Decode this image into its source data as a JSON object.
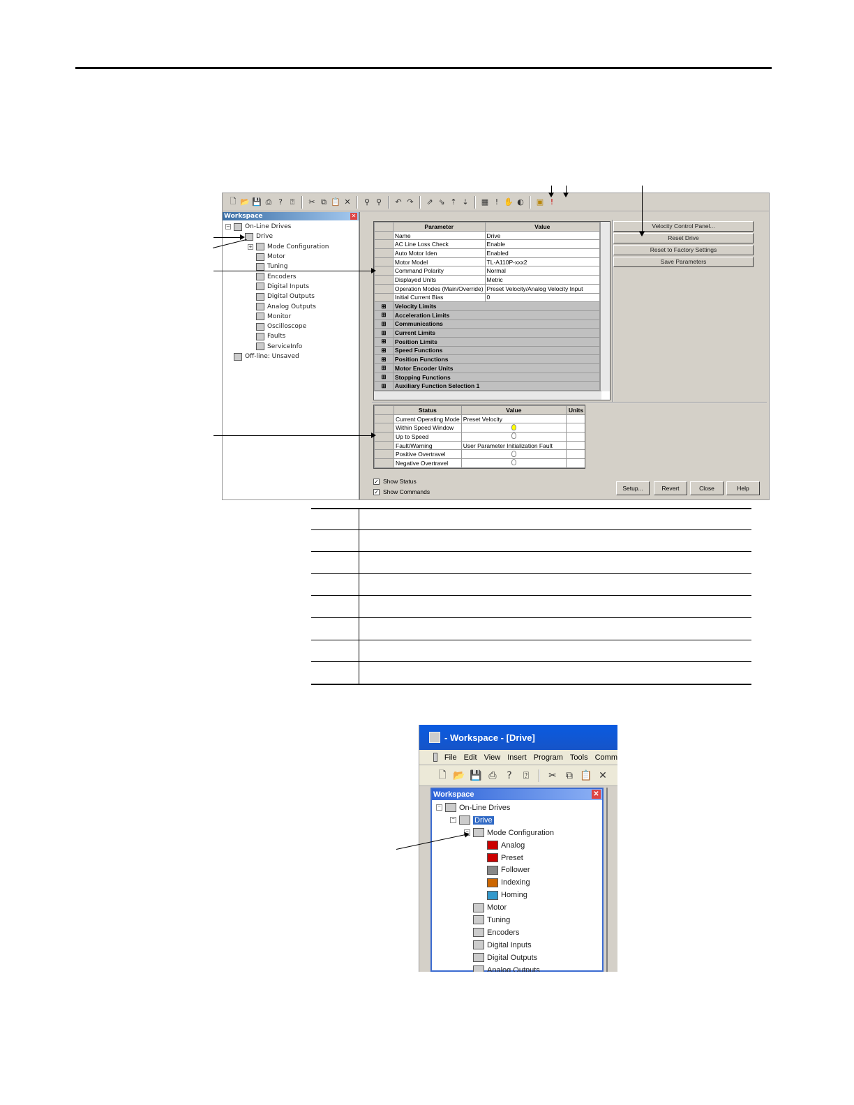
{
  "screenshot1": {
    "toolbar": {
      "icons": [
        "new-icon",
        "open-icon",
        "save-icon",
        "print-icon",
        "help-icon",
        "context-help-icon",
        "cut-icon",
        "copy-icon",
        "paste-icon",
        "delete-icon",
        "find-icon",
        "find-next-icon",
        "undo-icon",
        "redo-icon",
        "connect-icon",
        "disconnect-icon",
        "upload-icon",
        "download-icon",
        "calculator-icon",
        "enable-icon",
        "stop-icon",
        "home-icon",
        "properties-icon",
        "warning-icon"
      ]
    },
    "workspace": {
      "title": "Workspace",
      "items": [
        {
          "label": "On-Line Drives",
          "level": 0,
          "expander": "−"
        },
        {
          "label": "Drive",
          "level": 1,
          "expander": ""
        },
        {
          "label": "Mode Configuration",
          "level": 2,
          "expander": "+"
        },
        {
          "label": "Motor",
          "level": 2,
          "expander": ""
        },
        {
          "label": "Tuning",
          "level": 2,
          "expander": ""
        },
        {
          "label": "Encoders",
          "level": 2,
          "expander": ""
        },
        {
          "label": "Digital Inputs",
          "level": 2,
          "expander": ""
        },
        {
          "label": "Digital Outputs",
          "level": 2,
          "expander": ""
        },
        {
          "label": "Analog Outputs",
          "level": 2,
          "expander": ""
        },
        {
          "label": "Monitor",
          "level": 2,
          "expander": ""
        },
        {
          "label": "Oscilloscope",
          "level": 2,
          "expander": ""
        },
        {
          "label": "Faults",
          "level": 2,
          "expander": ""
        },
        {
          "label": "ServiceInfo",
          "level": 2,
          "expander": ""
        },
        {
          "label": "Off-line: Unsaved",
          "level": 0,
          "expander": ""
        }
      ]
    },
    "params": {
      "col_param": "Parameter",
      "col_value": "Value",
      "rows": [
        {
          "name": "Name",
          "value": "Drive"
        },
        {
          "name": "AC Line Loss Check",
          "value": "Enable"
        },
        {
          "name": "Auto Motor Iden",
          "value": "Enabled"
        },
        {
          "name": "Motor Model",
          "value": "TL-A110P-xxx2"
        },
        {
          "name": "Command Polarity",
          "value": "Normal"
        },
        {
          "name": "Displayed Units",
          "value": "Metric"
        },
        {
          "name": "Operation Modes (Main/Override)",
          "value": "Preset Velocity/Analog Velocity Input"
        },
        {
          "name": "Initial Current Bias",
          "value": "0"
        }
      ],
      "groups": [
        "Velocity Limits",
        "Acceleration Limits",
        "Communications",
        "Current Limits",
        "Position Limits",
        "Speed Functions",
        "Position Functions",
        "Motor Encoder Units",
        "Stopping Functions",
        "Auxiliary Function Selection 1"
      ]
    },
    "buttons": [
      "Velocity Control Panel...",
      "Reset Drive",
      "Reset to Factory Settings",
      "Save Parameters"
    ],
    "status": {
      "col_status": "Status",
      "col_value": "Value",
      "col_units": "Units",
      "rows": [
        {
          "name": "Current Operating Mode",
          "value": "Preset Velocity",
          "bulb": ""
        },
        {
          "name": "Within Speed Window",
          "value": "",
          "bulb": "on"
        },
        {
          "name": "Up to Speed",
          "value": "",
          "bulb": "off"
        },
        {
          "name": "Fault/Warning",
          "value": "User Parameter Initialization Fault",
          "bulb": ""
        },
        {
          "name": "Positive Overtravel",
          "value": "",
          "bulb": "off"
        },
        {
          "name": "Negative Overtravel",
          "value": "",
          "bulb": "off"
        }
      ]
    },
    "checkboxes": {
      "show_status": "Show Status",
      "show_commands": "Show Commands"
    },
    "bottom_buttons": [
      "Setup...",
      "Revert",
      "Close",
      "Help"
    ]
  },
  "screenshot2": {
    "title": "- Workspace - [Drive]",
    "menu": [
      "File",
      "Edit",
      "View",
      "Insert",
      "Program",
      "Tools",
      "Comm"
    ],
    "workspace_title": "Workspace",
    "items": [
      {
        "label": "On-Line Drives",
        "level": 0,
        "expander": "−"
      },
      {
        "label": "Drive",
        "level": 1,
        "expander": "−"
      },
      {
        "label": "Mode Configuration",
        "level": 2,
        "expander": "−"
      },
      {
        "label": "Analog",
        "level": 3,
        "expander": ""
      },
      {
        "label": "Preset",
        "level": 3,
        "expander": ""
      },
      {
        "label": "Follower",
        "level": 3,
        "expander": ""
      },
      {
        "label": "Indexing",
        "level": 3,
        "expander": ""
      },
      {
        "label": "Homing",
        "level": 3,
        "expander": ""
      },
      {
        "label": "Motor",
        "level": 2,
        "expander": ""
      },
      {
        "label": "Tuning",
        "level": 2,
        "expander": ""
      },
      {
        "label": "Encoders",
        "level": 2,
        "expander": ""
      },
      {
        "label": "Digital Inputs",
        "level": 2,
        "expander": ""
      },
      {
        "label": "Digital Outputs",
        "level": 2,
        "expander": ""
      },
      {
        "label": "Analog Outputs",
        "level": 2,
        "expander": ""
      }
    ]
  },
  "colors": {
    "title_blue": "#0a5be0",
    "selection": "#316ac5",
    "panel": "#d4d0c8"
  }
}
